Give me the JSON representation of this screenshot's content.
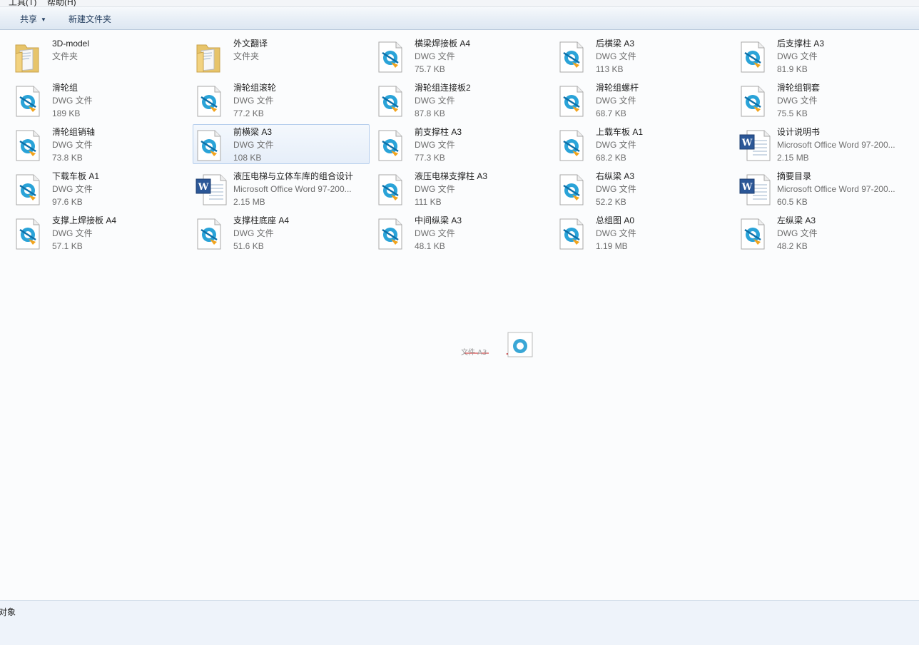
{
  "menubar": {
    "tools": "工具(T)",
    "help": "帮助(H)"
  },
  "toolbar": {
    "share": "共享",
    "new_folder": "新建文件夹"
  },
  "items": [
    {
      "name": "3D-model",
      "type": "文件夹",
      "size": "",
      "icon": "folder-icon",
      "selected": false
    },
    {
      "name": "外文翻译",
      "type": "文件夹",
      "size": "",
      "icon": "folder-icon",
      "selected": false
    },
    {
      "name": "横梁焊接板 A4",
      "type": "DWG 文件",
      "size": "75.7 KB",
      "icon": "dwg-file-icon",
      "selected": false
    },
    {
      "name": "后横梁 A3",
      "type": "DWG 文件",
      "size": "113 KB",
      "icon": "dwg-file-icon",
      "selected": false
    },
    {
      "name": "后支撑柱 A3",
      "type": "DWG 文件",
      "size": "81.9 KB",
      "icon": "dwg-file-icon",
      "selected": false
    },
    {
      "name": "滑轮组",
      "type": "DWG 文件",
      "size": "189 KB",
      "icon": "dwg-file-icon",
      "selected": false
    },
    {
      "name": "滑轮组滚轮",
      "type": "DWG 文件",
      "size": "77.2 KB",
      "icon": "dwg-file-icon",
      "selected": false
    },
    {
      "name": "滑轮组连接板2",
      "type": "DWG 文件",
      "size": "87.8 KB",
      "icon": "dwg-file-icon",
      "selected": false
    },
    {
      "name": "滑轮组螺杆",
      "type": "DWG 文件",
      "size": "68.7 KB",
      "icon": "dwg-file-icon",
      "selected": false
    },
    {
      "name": "滑轮组铜套",
      "type": "DWG 文件",
      "size": "75.5 KB",
      "icon": "dwg-file-icon",
      "selected": false
    },
    {
      "name": "滑轮组销轴",
      "type": "DWG 文件",
      "size": "73.8 KB",
      "icon": "dwg-file-icon",
      "selected": false
    },
    {
      "name": "前横梁 A3",
      "type": "DWG 文件",
      "size": "108 KB",
      "icon": "dwg-file-icon",
      "selected": true
    },
    {
      "name": "前支撑柱 A3",
      "type": "DWG 文件",
      "size": "77.3 KB",
      "icon": "dwg-file-icon",
      "selected": false
    },
    {
      "name": "上载车板 A1",
      "type": "DWG 文件",
      "size": "68.2 KB",
      "icon": "dwg-file-icon",
      "selected": false
    },
    {
      "name": "设计说明书",
      "type": "Microsoft Office Word 97-200...",
      "size": "2.15 MB",
      "icon": "word-document-icon",
      "selected": false
    },
    {
      "name": "下载车板 A1",
      "type": "DWG 文件",
      "size": "97.6 KB",
      "icon": "dwg-file-icon",
      "selected": false
    },
    {
      "name": "液压电梯与立体车库的组合设计",
      "type": "Microsoft Office Word 97-200...",
      "size": "2.15 MB",
      "icon": "word-document-icon",
      "selected": false
    },
    {
      "name": "液压电梯支撑柱 A3",
      "type": "DWG 文件",
      "size": "111 KB",
      "icon": "dwg-file-icon",
      "selected": false
    },
    {
      "name": "右纵梁 A3",
      "type": "DWG 文件",
      "size": "52.2 KB",
      "icon": "dwg-file-icon",
      "selected": false
    },
    {
      "name": "摘要目录",
      "type": "Microsoft Office Word 97-200...",
      "size": "60.5 KB",
      "icon": "word-document-icon",
      "selected": false
    },
    {
      "name": "支撑上焊接板 A4",
      "type": "DWG 文件",
      "size": "57.1 KB",
      "icon": "dwg-file-icon",
      "selected": false
    },
    {
      "name": "支撑柱底座 A4",
      "type": "DWG 文件",
      "size": "51.6 KB",
      "icon": "dwg-file-icon",
      "selected": false
    },
    {
      "name": "中间纵梁 A3",
      "type": "DWG 文件",
      "size": "48.1 KB",
      "icon": "dwg-file-icon",
      "selected": false
    },
    {
      "name": "总组图 A0",
      "type": "DWG 文件",
      "size": "1.19 MB",
      "icon": "dwg-file-icon",
      "selected": false
    },
    {
      "name": "左纵梁 A3",
      "type": "DWG 文件",
      "size": "48.2 KB",
      "icon": "dwg-file-icon",
      "selected": false
    }
  ],
  "status": {
    "text": "对象"
  },
  "colors": {
    "selection": "#e6eef9",
    "selection_border": "#b7cfed",
    "toolbar": "#e7eef6",
    "link": "#1e395b"
  }
}
